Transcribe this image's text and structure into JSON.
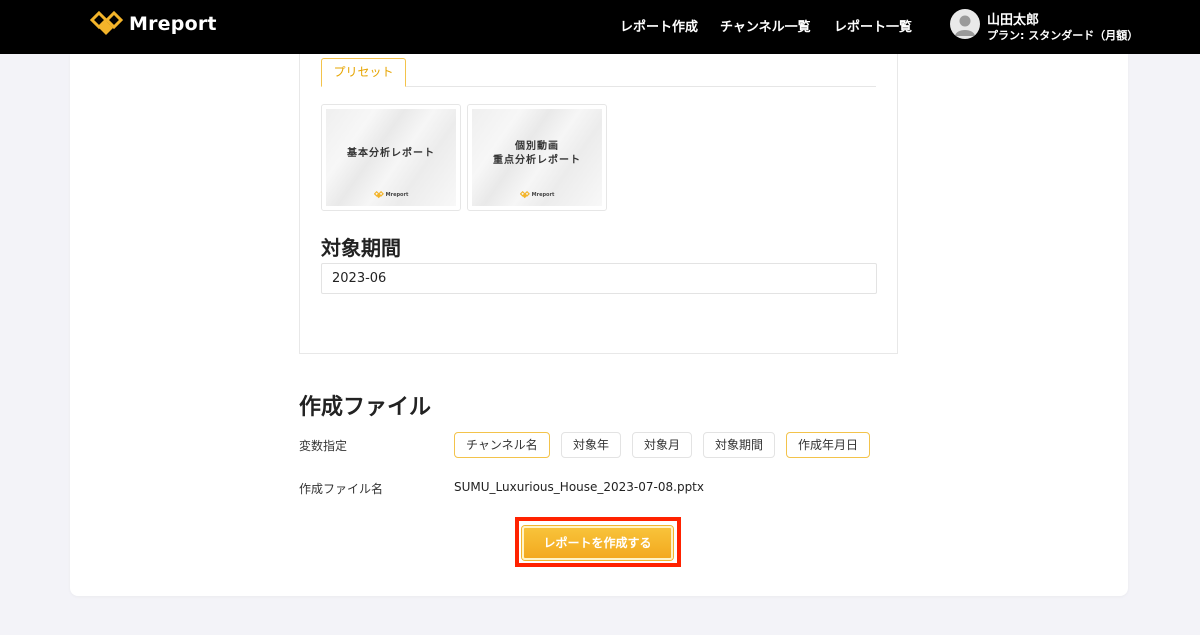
{
  "header": {
    "logo_text": "Mreport",
    "nav": [
      "レポート作成",
      "チャンネル一覧",
      "レポート一覧"
    ],
    "user": {
      "name": "山田太郎",
      "plan": "プラン: スタンダード（月額）"
    }
  },
  "preset": {
    "tab_label": "プリセット",
    "cards": [
      {
        "title_lines": [
          "基本分析レポート"
        ],
        "logo_text": "Mreport"
      },
      {
        "title_lines": [
          "個別動画",
          "重点分析レポート"
        ],
        "logo_text": "Mreport"
      }
    ]
  },
  "period": {
    "title": "対象期間",
    "value": "2023-06"
  },
  "file": {
    "title": "作成ファイル",
    "vars_label": "変数指定",
    "vars": [
      {
        "label": "チャンネル名",
        "active": true
      },
      {
        "label": "対象年",
        "active": false
      },
      {
        "label": "対象月",
        "active": false
      },
      {
        "label": "対象期間",
        "active": false
      },
      {
        "label": "作成年月日",
        "active": true
      }
    ],
    "name_label": "作成ファイル名",
    "name_value": "SUMU_Luxurious_House_2023-07-08.pptx"
  },
  "actions": {
    "create_label": "レポートを作成する"
  },
  "colors": {
    "accent": "#f3b42a",
    "highlight": "#ff2200",
    "header_bg": "#000000"
  }
}
